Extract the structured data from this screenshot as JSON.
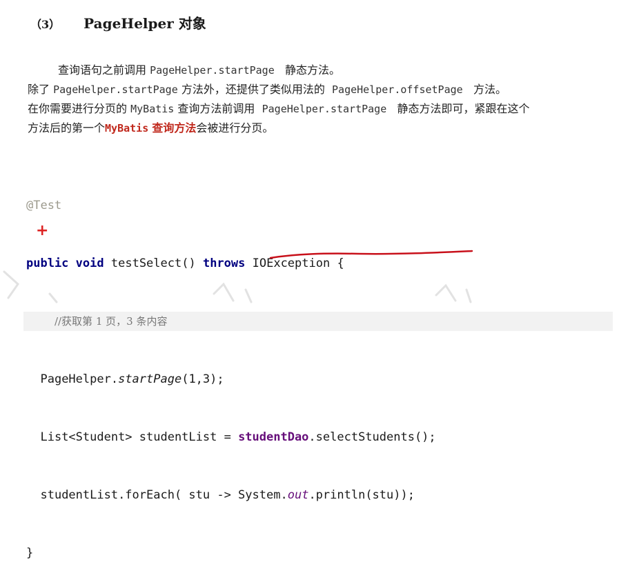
{
  "heading": {
    "number": "（3）",
    "title": "PageHelper 对象"
  },
  "paragraph": {
    "line1": {
      "a": "查询语句之前调用",
      "b": "PageHelper.startPage",
      "c": "静态方法。"
    },
    "line2": {
      "a": "除了",
      "b": "PageHelper.startPage",
      "c": "方法外，还提供了类似用法的",
      "d": "PageHelper.offsetPage",
      "e": "方法。"
    },
    "line3": {
      "a": "在你需要进行分页的",
      "b": "MyBatis",
      "c": "查询方法前调用",
      "d": "PageHelper.startPage",
      "e": "静态方法即可，紧跟在这个"
    },
    "line4": {
      "a": "方法后的第一个",
      "b": "MyBatis",
      "c": "查询方法",
      "d": "会被进行分页。"
    }
  },
  "code": {
    "annotation": "@Test",
    "sig_public": "public",
    "sig_void": "void",
    "sig_name": "testSelect()",
    "sig_throws": "throws",
    "sig_exc": "IOException {",
    "comment": "//获取第 1 页，3 条内容",
    "l3_a": "PageHelper.",
    "l3_b": "startPage",
    "l3_c": "(1,3);",
    "l4_a": "List<Student> studentList = ",
    "l4_b": "studentDao",
    "l4_c": ".selectStudents();",
    "l5_a": "studentList.forEach( stu -> System.",
    "l5_b": "out",
    "l5_c": ".println(stu));",
    "close": "}"
  },
  "marks": {
    "plus": "+"
  },
  "colors": {
    "keyword": "#000080",
    "field": "#660e7a",
    "annotation": "#9c9a8d",
    "emphasis": "#c0281c",
    "pen": "#c8101a"
  }
}
